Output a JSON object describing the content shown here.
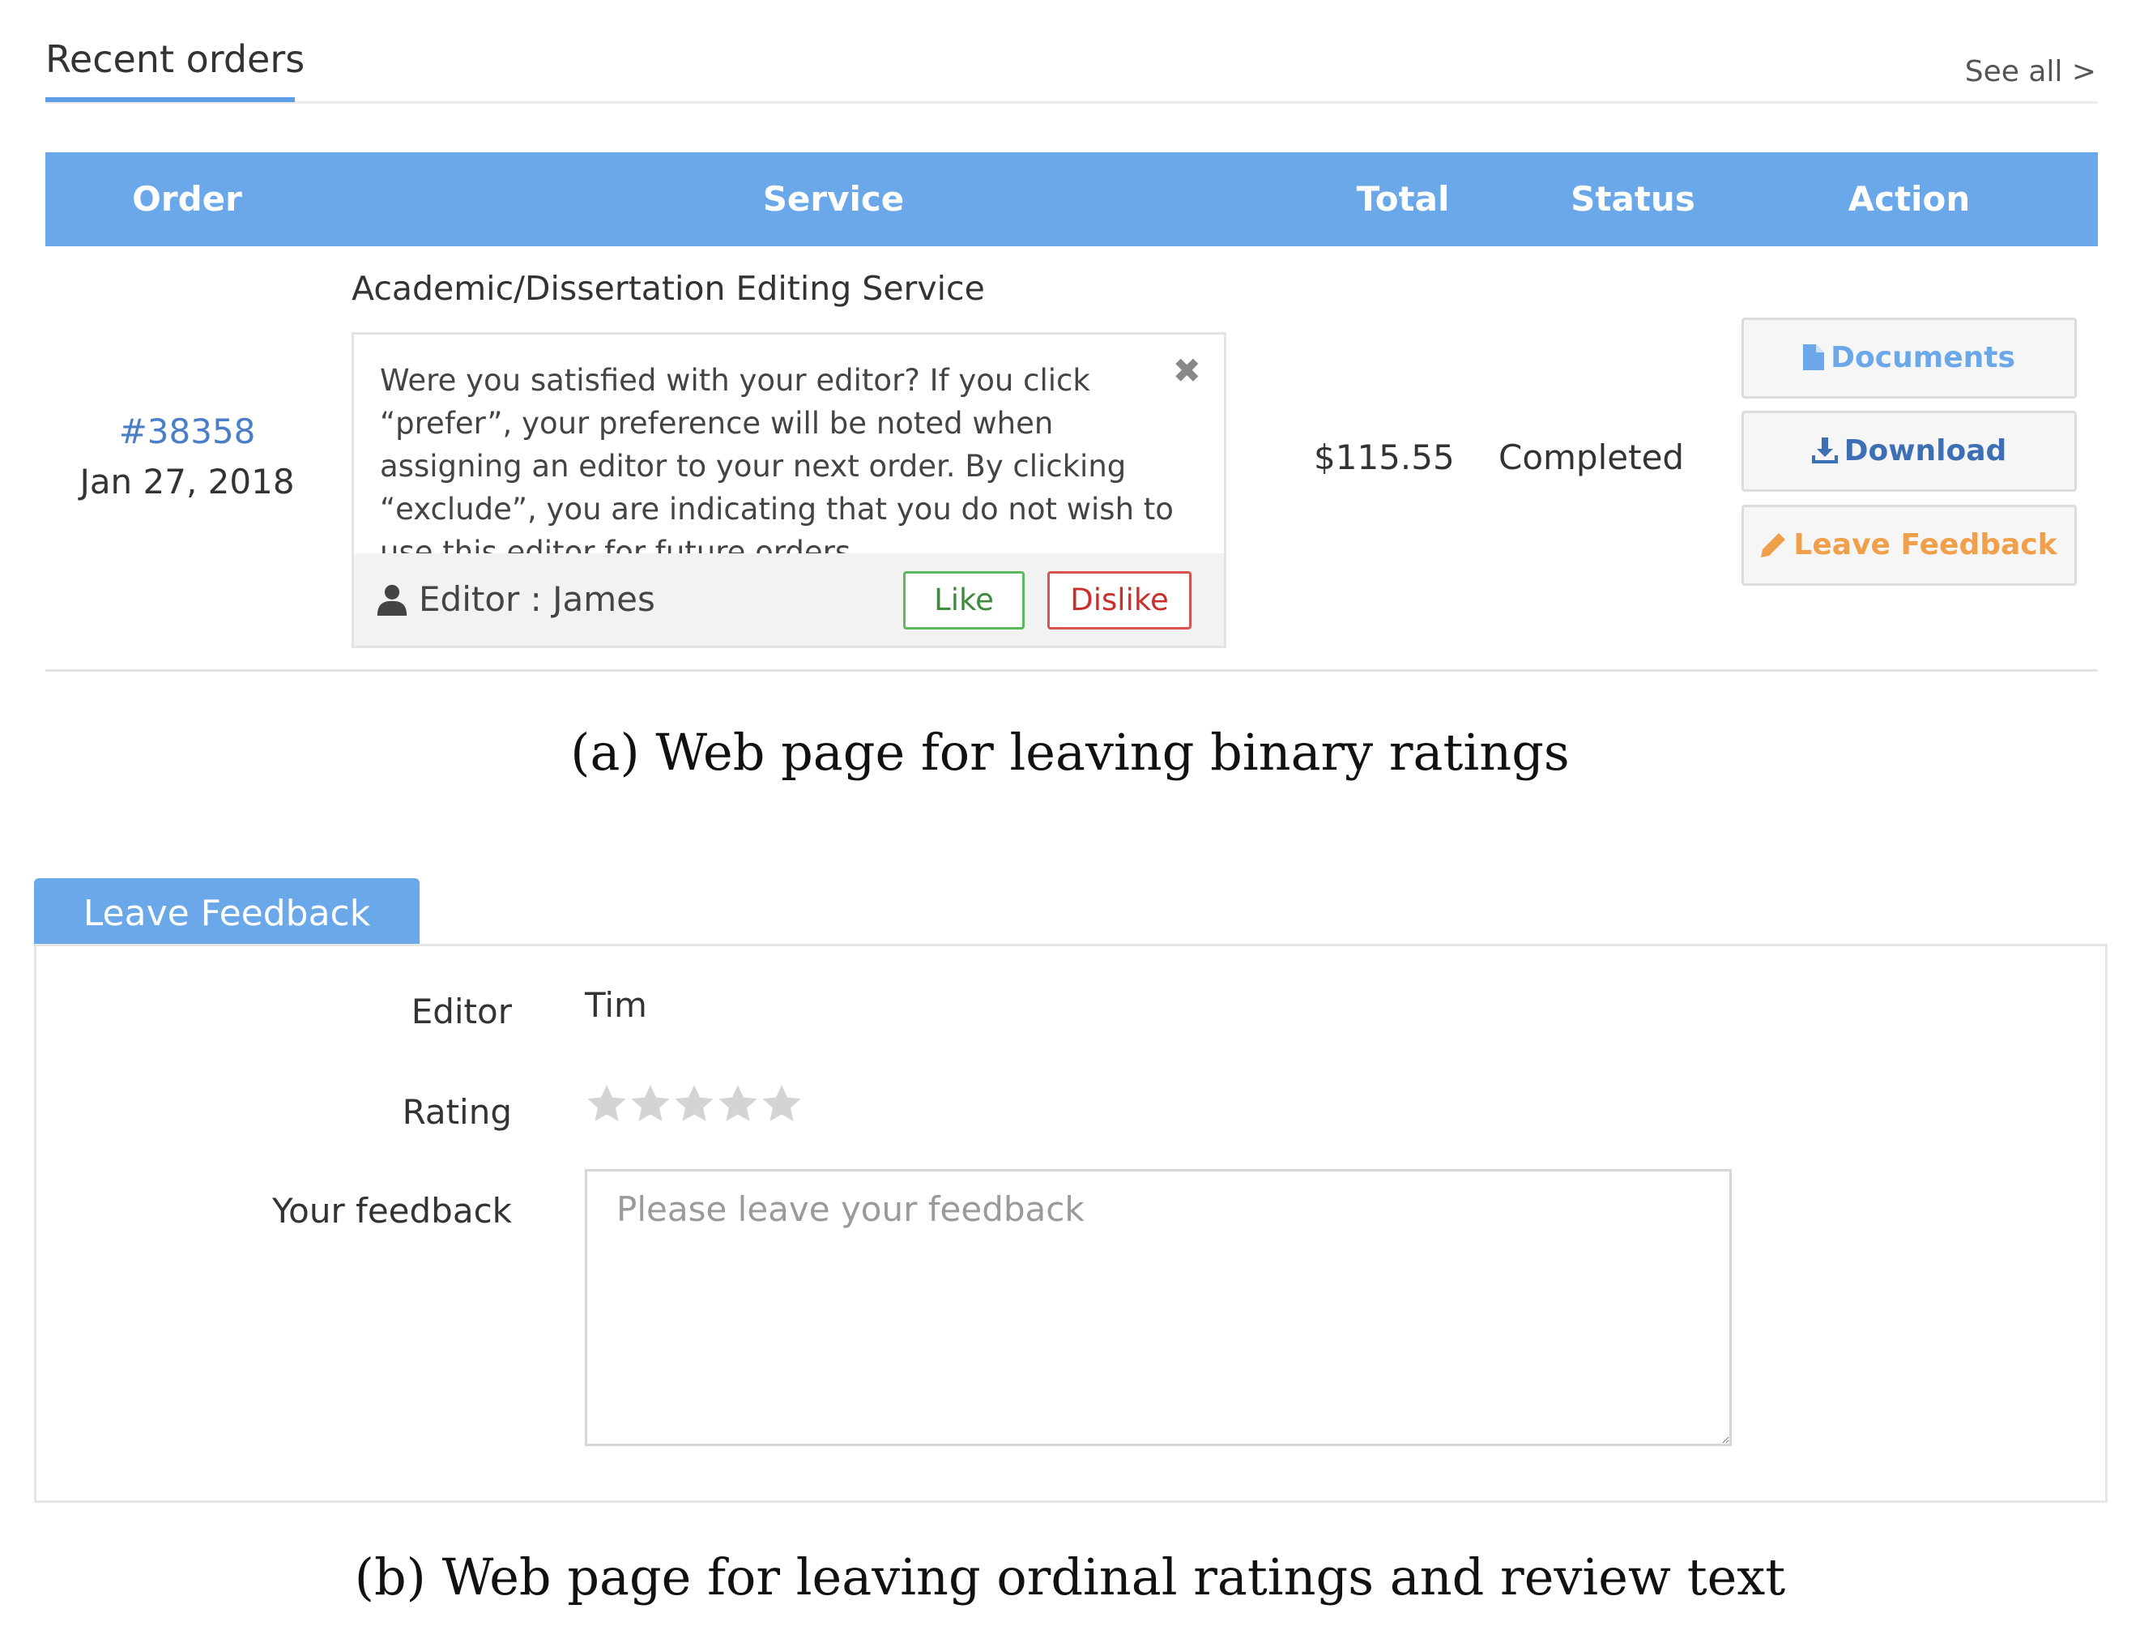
{
  "orders": {
    "title": "Recent orders",
    "see_all": "See all >",
    "columns": [
      "Order",
      "Service",
      "Total",
      "Status",
      "Action"
    ],
    "row": {
      "order_number": "#38358",
      "date": "Jan 27, 2018",
      "service": "Academic/Dissertation Editing Service",
      "total": "$115.55",
      "status": "Completed"
    },
    "satisfaction_prompt": {
      "text": "Were you satisfied with your editor? If you click “prefer”, your preference will be noted when assigning an editor to your next order. By clicking “exclude”, you are indicating that you do not wish to use this editor for future orders.",
      "close_glyph": "✖",
      "editor": "Editor : James",
      "like_label": "Like",
      "dislike_label": "Dislike"
    },
    "actions": {
      "documents_label": "Documents",
      "download_label": "Download",
      "feedback_label": "Leave Feedback"
    }
  },
  "captions": {
    "a": "(a)  Web page for leaving binary ratings",
    "b": "(b)  Web page for leaving ordinal ratings and review text"
  },
  "feedback_form": {
    "tab_label": "Leave Feedback",
    "editor_label": "Editor",
    "editor_value": "Tim",
    "rating_label": "Rating",
    "rating_value": 0,
    "rating_max": 5,
    "feedback_label": "Your feedback",
    "feedback_placeholder": "Please leave your feedback",
    "feedback_value": ""
  },
  "colors": {
    "accent": "#6aa8ea",
    "link": "#4a7fc7",
    "like": "#5cb85c",
    "dislike": "#d9534f",
    "feedback_action": "#f0a04b",
    "star_empty": "#d4d4d4"
  }
}
